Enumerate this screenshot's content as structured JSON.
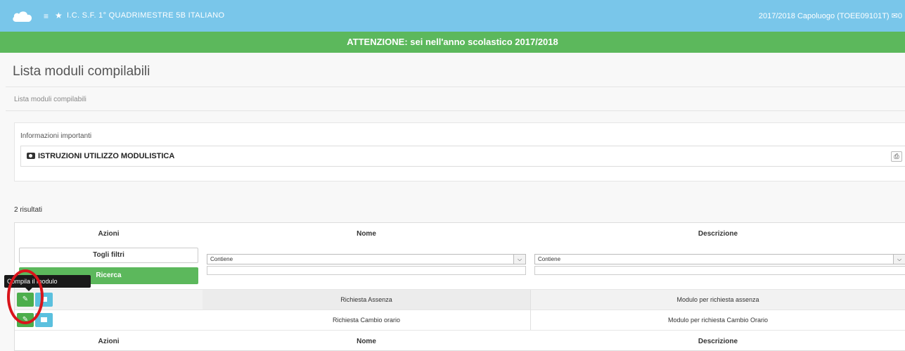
{
  "topbar": {
    "menu_icon": "hamburger-icon",
    "star_icon": "star-icon",
    "title": "I.C. S.F. 1° QUADRIMESTRE 5B ITALIANO",
    "right": "2017/2018 Capoluogo (TOEE09101T) ✉0"
  },
  "alert": {
    "text": "ATTENZIONE: sei nell'anno scolastico 2017/2018"
  },
  "page": {
    "title": "Lista moduli compilabili",
    "breadcrumb": "Lista moduli compilabili"
  },
  "info": {
    "label": "Informazioni importanti",
    "doc_title": "ISTRUZIONI UTILIZZO MODULISTICA",
    "print_icon": "print-icon"
  },
  "results": "2 risultati",
  "table": {
    "headers": [
      "Azioni",
      "Nome",
      "Descrizione"
    ],
    "togli_filtri": "Togli filtri",
    "ricerca": "Ricerca",
    "filter_nome": "Contiene",
    "filter_descrizione": "Contiene",
    "rows": [
      {
        "nome": "Richiesta Assenza",
        "descrizione": "Modulo per richiesta assenza"
      },
      {
        "nome": "Richiesta Cambio orario",
        "descrizione": "Modulo per richiesta Cambio Orario"
      }
    ]
  },
  "tooltip": "Compila il modulo",
  "colors": {
    "topbar": "#79c6ea",
    "alert": "#5cb85c",
    "edit_button": "#4cae4c",
    "view_button": "#5bc0de",
    "highlight": "#d9151b"
  }
}
